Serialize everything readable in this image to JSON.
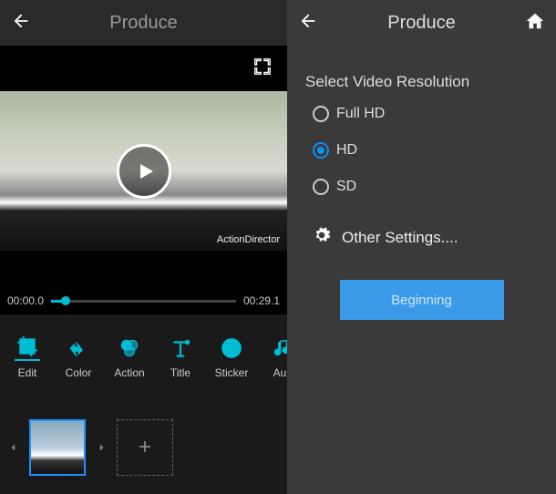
{
  "left": {
    "title": "Produce",
    "watermark": "ActionDirector",
    "time_current": "00:00.0",
    "time_total": "00:29.1",
    "tools": [
      {
        "label": "Edit"
      },
      {
        "label": "Color"
      },
      {
        "label": "Action"
      },
      {
        "label": "Title"
      },
      {
        "label": "Sticker"
      },
      {
        "label": "Auk"
      }
    ],
    "add_clip_symbol": "+"
  },
  "right": {
    "title": "Produce",
    "section_title": "Select Video Resolution",
    "options": [
      {
        "label": "Full HD",
        "selected": false
      },
      {
        "label": "HD",
        "selected": true
      },
      {
        "label": "SD",
        "selected": false
      }
    ],
    "other_settings_label": "Other Settings....",
    "begin_label": "Beginning"
  }
}
